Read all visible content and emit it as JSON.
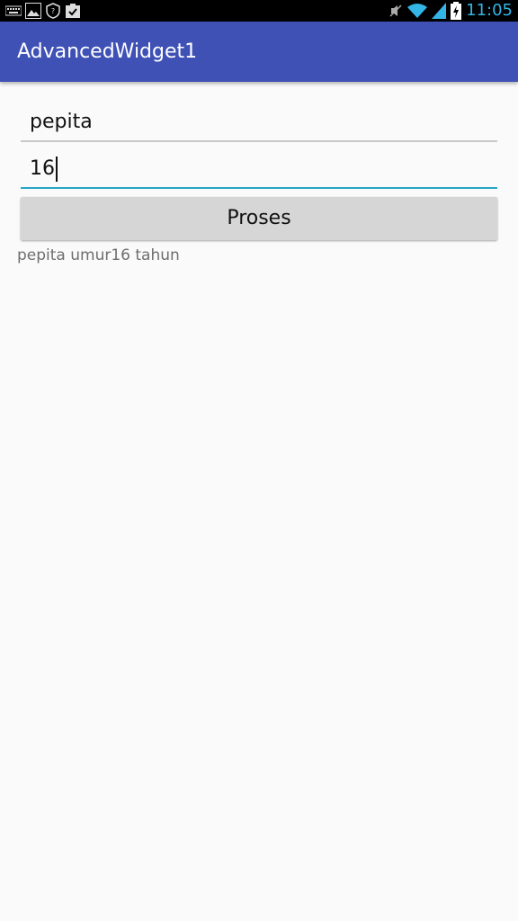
{
  "status_bar": {
    "time": "11:05",
    "icons": [
      "keyboard-icon",
      "image-icon",
      "shield-icon",
      "clipboard-check-icon",
      "mute-icon",
      "wifi-icon",
      "signal-icon",
      "battery-charging-icon"
    ]
  },
  "app_bar": {
    "title": "AdvancedWidget1"
  },
  "form": {
    "name_value": "pepita",
    "age_value": "16",
    "button_label": "Proses",
    "result_text": "pepita umur16 tahun"
  },
  "colors": {
    "app_bar": "#3f51b5",
    "accent": "#26a5c7",
    "status_icons": "#33b5e5"
  }
}
